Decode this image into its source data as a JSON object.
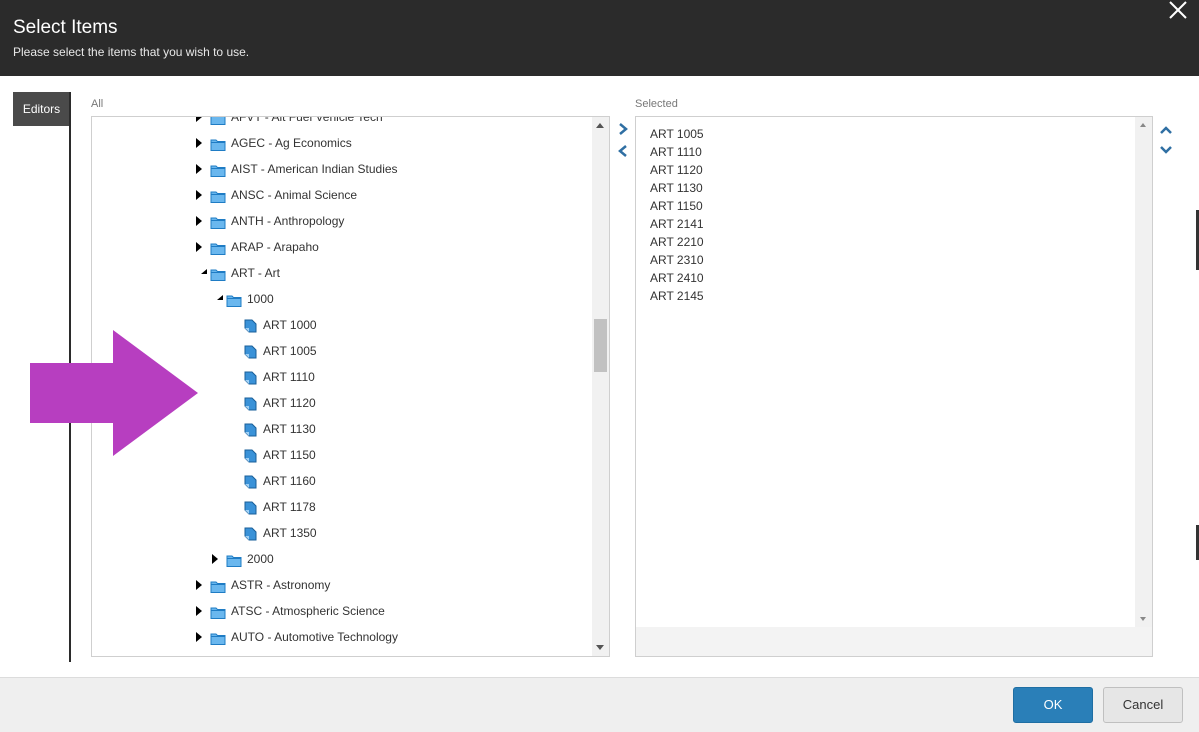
{
  "header": {
    "title": "Select Items",
    "subtitle": "Please select the items that you wish to use.",
    "close_icon": "close-icon"
  },
  "tabs": [
    {
      "label": "Editors",
      "active": true
    }
  ],
  "all_panel": {
    "label": "All",
    "rows": [
      {
        "text": "AFVT - Alt Fuel Vehicle Tech",
        "type": "folder",
        "state": "collapsed",
        "level": 0
      },
      {
        "text": "AGEC - Ag Economics",
        "type": "folder",
        "state": "collapsed",
        "level": 0
      },
      {
        "text": "AIST - American Indian Studies",
        "type": "folder",
        "state": "collapsed",
        "level": 0
      },
      {
        "text": "ANSC - Animal Science",
        "type": "folder",
        "state": "collapsed",
        "level": 0
      },
      {
        "text": "ANTH - Anthropology",
        "type": "folder",
        "state": "collapsed",
        "level": 0
      },
      {
        "text": "ARAP - Arapaho",
        "type": "folder",
        "state": "collapsed",
        "level": 0
      },
      {
        "text": "ART - Art",
        "type": "folder",
        "state": "expanded",
        "level": 0
      },
      {
        "text": "1000",
        "type": "folder",
        "state": "expanded",
        "level": 1
      },
      {
        "text": "ART 1000",
        "type": "item",
        "level": 2
      },
      {
        "text": "ART 1005",
        "type": "item",
        "level": 2
      },
      {
        "text": "ART 1110",
        "type": "item",
        "level": 2
      },
      {
        "text": "ART 1120",
        "type": "item",
        "level": 2
      },
      {
        "text": "ART 1130",
        "type": "item",
        "level": 2
      },
      {
        "text": "ART 1150",
        "type": "item",
        "level": 2
      },
      {
        "text": "ART 1160",
        "type": "item",
        "level": 2
      },
      {
        "text": "ART 1178",
        "type": "item",
        "level": 2
      },
      {
        "text": "ART 1350",
        "type": "item",
        "level": 2
      },
      {
        "text": "2000",
        "type": "folder",
        "state": "collapsed",
        "level": 1
      },
      {
        "text": "ASTR - Astronomy",
        "type": "folder",
        "state": "collapsed",
        "level": 0
      },
      {
        "text": "ATSC - Atmospheric Science",
        "type": "folder",
        "state": "collapsed",
        "level": 0
      },
      {
        "text": "AUTO - Automotive Technology",
        "type": "folder",
        "state": "collapsed",
        "level": 0
      }
    ]
  },
  "selected_panel": {
    "label": "Selected",
    "items": [
      "ART 1005",
      "ART 1110",
      "ART 1120",
      "ART 1130",
      "ART 1150",
      "ART 2141",
      "ART 2210",
      "ART 2310",
      "ART 2410",
      "ART 2145"
    ]
  },
  "footer": {
    "ok_label": "OK",
    "cancel_label": "Cancel"
  },
  "colors": {
    "header_bg": "#2b2b2b",
    "accent_blue": "#2a7fb8",
    "annotation_arrow": "#b73ec0",
    "folder_icon": "#2b8fd6"
  }
}
